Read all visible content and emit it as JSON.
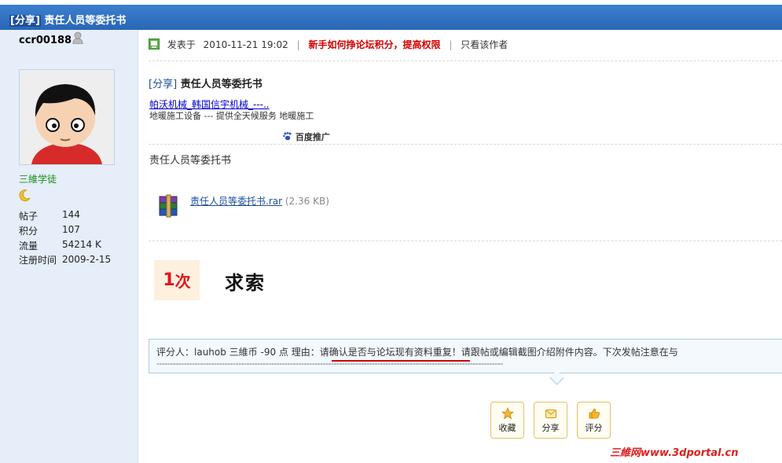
{
  "thread": {
    "tag": "[分享]",
    "title": "责任人员等委托书"
  },
  "user": {
    "name": "ccr00188",
    "rank": "三維学徒",
    "stats": [
      {
        "label": "帖子",
        "value": "144"
      },
      {
        "label": "积分",
        "value": "107"
      },
      {
        "label": "流量",
        "value": "54214 K"
      },
      {
        "label": "注册时间",
        "value": "2009-2-15"
      }
    ]
  },
  "post": {
    "posted_prefix": "发表于",
    "posted_time": "2010-11-21 19:02",
    "highlight_link": "新手如何挣论坛积分，提高权限",
    "separator": "|",
    "only_author": "只看该作者",
    "title_tag": "[分享]",
    "title": "责任人员等委托书",
    "ad_link": "帕沃机械_韩国信宇机械_---..",
    "ad_desc": "地暖施工设备 --- 提供全天候服务 地暖施工",
    "ad_brand": "百度推广",
    "body_text": "责任人员等委托书",
    "attachment_name": "责任人员等委托书.rar",
    "attachment_size": "(2.36 KB)",
    "count_num": "1",
    "count_unit": "次",
    "seek_text": "求索"
  },
  "rating": {
    "line": "评分人：lauhob 三維币  -90 点  理由：请确认是否与论坛现有资料重复！请跟帖或编辑截图介绍附件内容。下次发帖注意在与",
    "dashes": "-------------------------------------------------------------------------------------------------------------------------------"
  },
  "actions": [
    {
      "label": "收藏",
      "icon": "star-icon"
    },
    {
      "label": "分享",
      "icon": "share-icon"
    },
    {
      "label": "评分",
      "icon": "thumbs-up-icon"
    }
  ],
  "watermark": "三維网www.3dportal.cn",
  "colors": {
    "header_blue": "#2f70c2",
    "sidebar_bg": "#e5eef9",
    "highlight_red": "#d40000",
    "rate_border": "#a9c9e5"
  }
}
